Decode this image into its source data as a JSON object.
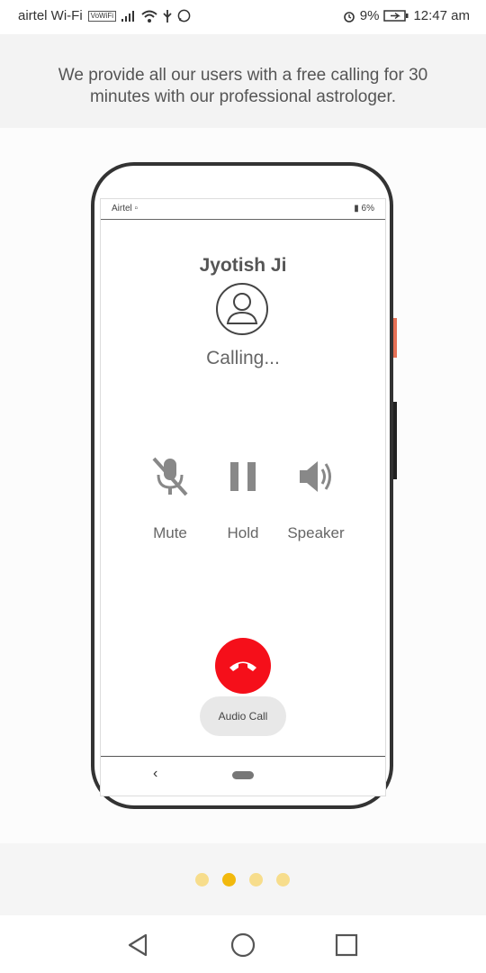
{
  "status_bar": {
    "carrier": "airtel Wi-Fi",
    "carrier_badge": "VoWiFi",
    "battery_percent": "9%",
    "time": "12:47 am",
    "icons": [
      "signal-icon",
      "wifi-icon",
      "usb-icon",
      "whatsapp-icon",
      "alarm-icon",
      "battery-charging-icon"
    ]
  },
  "intro_text": "We provide all our users with a free calling for 30 minutes with our professional astrologer.",
  "mock_call": {
    "mini_status_left": "Airtel ▫",
    "mini_status_right": "▮ 6%",
    "caller_name": "Jyotish Ji",
    "status": "Calling...",
    "controls": [
      {
        "label": "Mute",
        "icon": "mic-off-icon"
      },
      {
        "label": "Hold",
        "icon": "pause-icon"
      },
      {
        "label": "Speaker",
        "icon": "speaker-icon"
      }
    ],
    "end_call_icon": "end-call-icon",
    "call_type": "Audio Call"
  },
  "pager": {
    "total": 4,
    "active_index": 1,
    "active_color": "#f2b90d",
    "inactive_color": "#f7dd8c"
  },
  "system_nav": [
    "back-icon",
    "home-icon",
    "recents-icon"
  ],
  "colors": {
    "end_call": "#f50f1a",
    "accent": "#f2b90d"
  }
}
